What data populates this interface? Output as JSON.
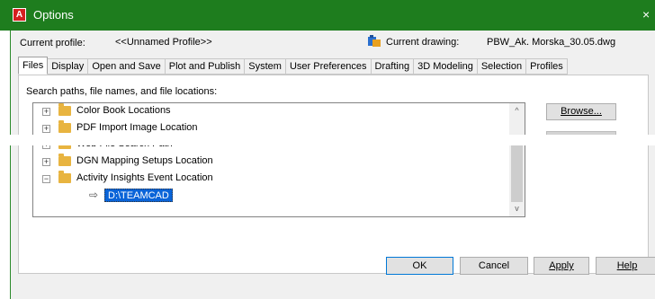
{
  "window": {
    "title": "Options",
    "close_glyph": "×"
  },
  "profile": {
    "label": "Current profile:",
    "value": "<<Unnamed Profile>>",
    "drawing_label": "Current drawing:",
    "drawing_value": "PBW_Ak. Morska_30.05.dwg"
  },
  "tabs": [
    {
      "label": "Files",
      "active": true
    },
    {
      "label": "Display"
    },
    {
      "label": "Open and Save"
    },
    {
      "label": "Plot and Publish"
    },
    {
      "label": "System"
    },
    {
      "label": "User Preferences"
    },
    {
      "label": "Drafting"
    },
    {
      "label": "3D Modeling"
    },
    {
      "label": "Selection"
    },
    {
      "label": "Profiles"
    }
  ],
  "files": {
    "section_label": "Search paths, file names, and file locations:",
    "tree": [
      {
        "label": "Color Book Locations",
        "expander": "+"
      },
      {
        "label": "PDF Import Image Location",
        "expander": "+"
      },
      {
        "label": "Web File Search Path",
        "expander": "+"
      },
      {
        "label": "DGN Mapping Setups Location",
        "expander": "+"
      },
      {
        "label": "Activity Insights Event Location",
        "expander": "−"
      }
    ],
    "selected_child": "D:\\TEAMCAD",
    "child_arrow": "⇨",
    "scroll_up": "^",
    "scroll_down": "v",
    "browse_label": "Browse..."
  },
  "buttons": {
    "ok": "OK",
    "cancel": "Cancel",
    "apply": "Apply",
    "help": "Help"
  },
  "icons": {
    "app": "autocad-icon",
    "drawing": "drawing-icon",
    "folder": "folder-icon"
  },
  "colors": {
    "titlebar": "#1e7d1e",
    "selection": "#0a64d8"
  }
}
